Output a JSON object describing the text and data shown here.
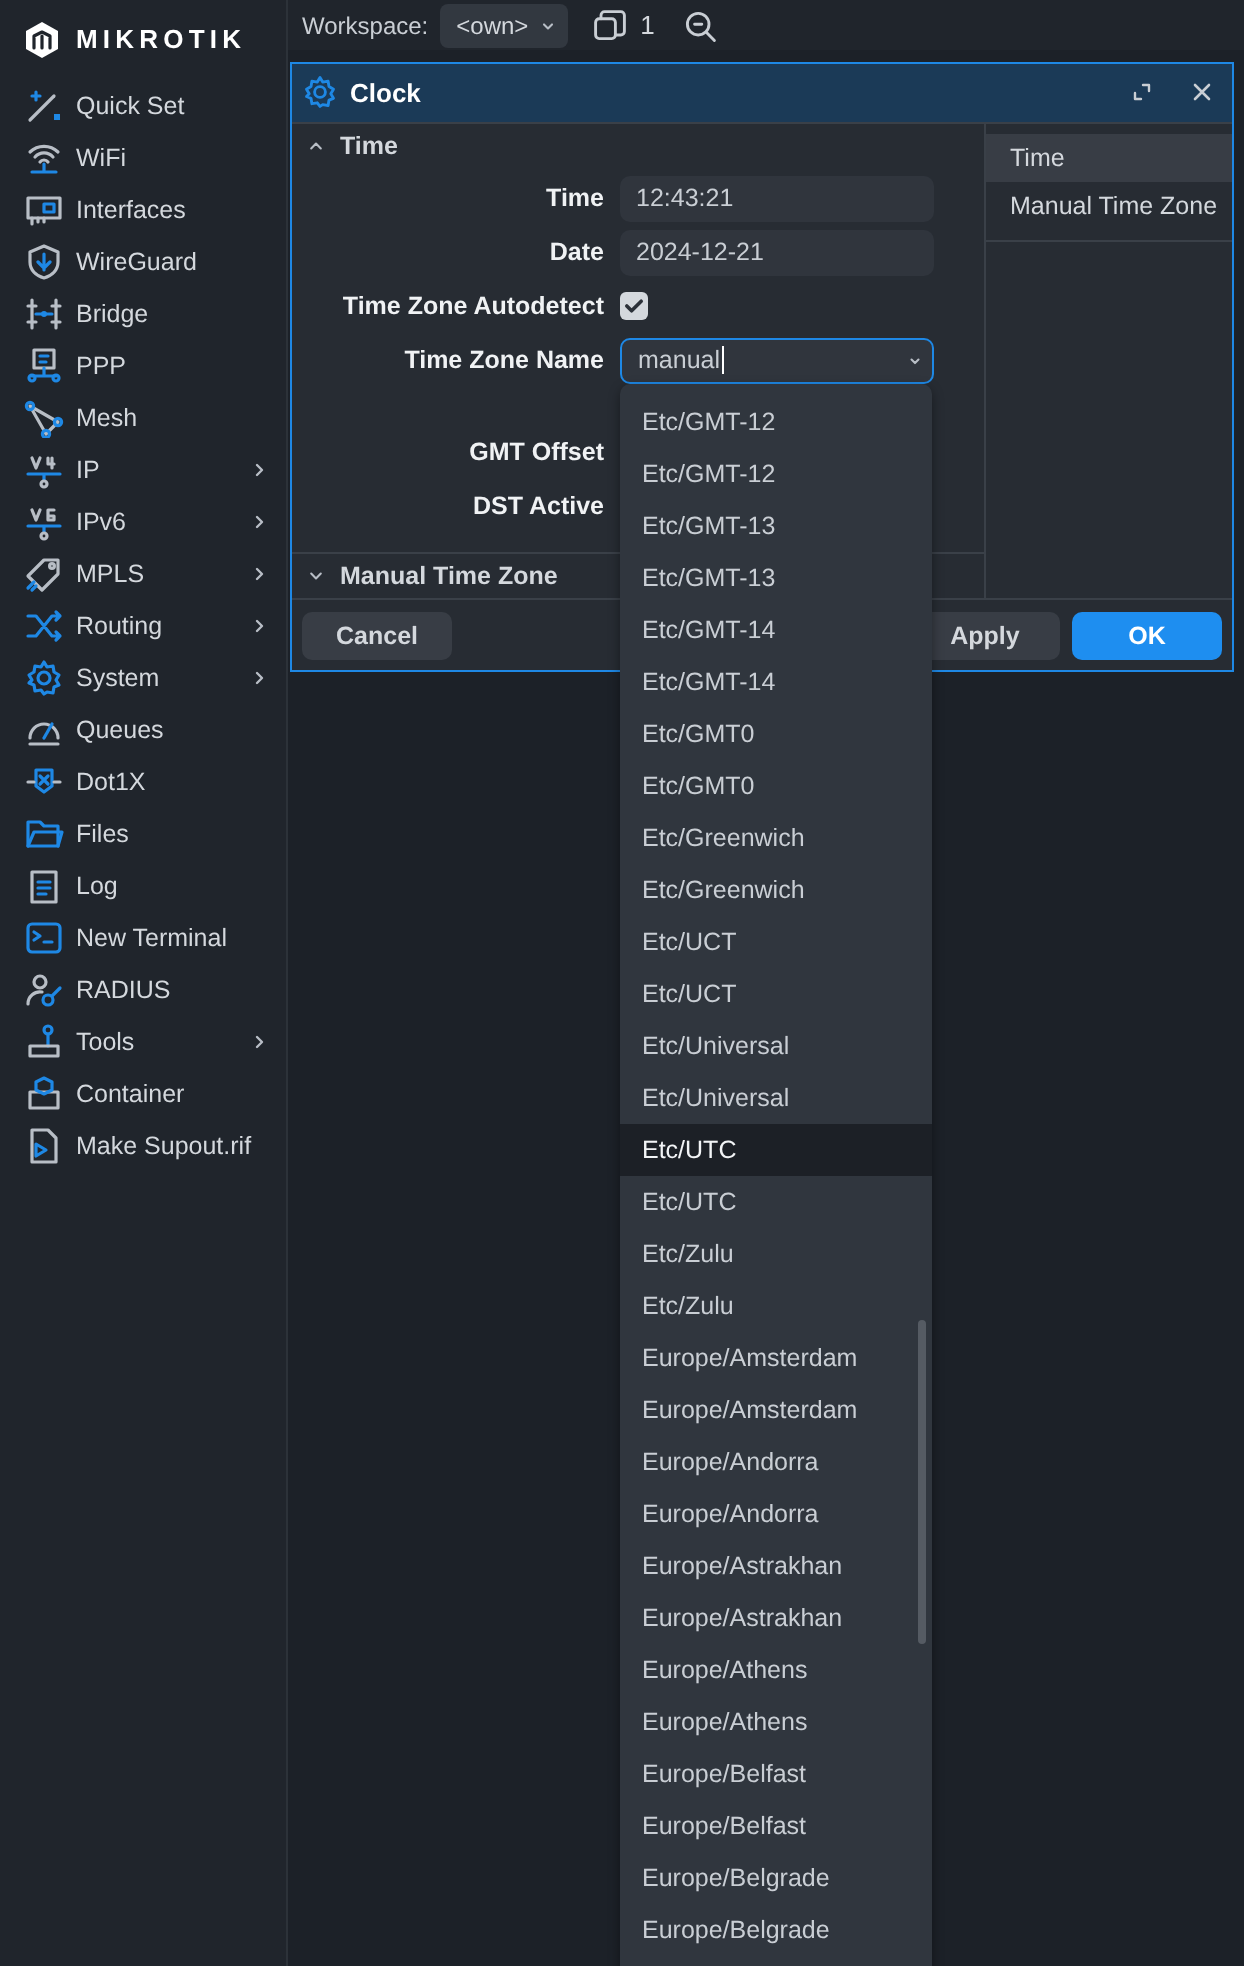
{
  "brand": {
    "name": "MIKROTIK"
  },
  "sidebar": {
    "items": [
      {
        "label": "Quick Set",
        "has_submenu": false
      },
      {
        "label": "WiFi",
        "has_submenu": false
      },
      {
        "label": "Interfaces",
        "has_submenu": false
      },
      {
        "label": "WireGuard",
        "has_submenu": false
      },
      {
        "label": "Bridge",
        "has_submenu": false
      },
      {
        "label": "PPP",
        "has_submenu": false
      },
      {
        "label": "Mesh",
        "has_submenu": false
      },
      {
        "label": "IP",
        "has_submenu": true
      },
      {
        "label": "IPv6",
        "has_submenu": true
      },
      {
        "label": "MPLS",
        "has_submenu": true
      },
      {
        "label": "Routing",
        "has_submenu": true
      },
      {
        "label": "System",
        "has_submenu": true
      },
      {
        "label": "Queues",
        "has_submenu": false
      },
      {
        "label": "Dot1X",
        "has_submenu": false
      },
      {
        "label": "Files",
        "has_submenu": false
      },
      {
        "label": "Log",
        "has_submenu": false
      },
      {
        "label": "New Terminal",
        "has_submenu": false
      },
      {
        "label": "RADIUS",
        "has_submenu": false
      },
      {
        "label": "Tools",
        "has_submenu": true
      },
      {
        "label": "Container",
        "has_submenu": false
      },
      {
        "label": "Make Supout.rif",
        "has_submenu": false
      }
    ]
  },
  "toolbar": {
    "workspace_label": "Workspace:",
    "workspace_value": "<own>",
    "window_count": "1"
  },
  "window": {
    "title": "Clock",
    "sections": [
      {
        "title": "Time",
        "expanded": true,
        "fields": [
          {
            "kind": "text",
            "label": "Time",
            "value": "12:43:21"
          },
          {
            "kind": "text",
            "label": "Date",
            "value": "2024-12-21"
          },
          {
            "kind": "checkbox",
            "label": "Time Zone Autodetect",
            "checked": true
          },
          {
            "kind": "select",
            "label": "Time Zone Name",
            "value": "manual",
            "focused": true
          },
          {
            "kind": "label",
            "label": "GMT Offset"
          },
          {
            "kind": "label",
            "label": "DST Active"
          }
        ]
      },
      {
        "title": "Manual Time Zone",
        "expanded": false
      }
    ],
    "nav": [
      {
        "label": "Time",
        "selected": true
      },
      {
        "label": "Manual Time Zone",
        "selected": false
      }
    ],
    "buttons": [
      {
        "label": "Cancel",
        "kind": "secondary"
      },
      {
        "label": "Apply",
        "kind": "secondary"
      },
      {
        "label": "OK",
        "kind": "primary"
      }
    ]
  },
  "dropdown": {
    "options": [
      {
        "label": "Etc/GMT-12",
        "highlighted": false
      },
      {
        "label": "Etc/GMT-12",
        "highlighted": false
      },
      {
        "label": "Etc/GMT-13",
        "highlighted": false
      },
      {
        "label": "Etc/GMT-13",
        "highlighted": false
      },
      {
        "label": "Etc/GMT-14",
        "highlighted": false
      },
      {
        "label": "Etc/GMT-14",
        "highlighted": false
      },
      {
        "label": "Etc/GMT0",
        "highlighted": false
      },
      {
        "label": "Etc/GMT0",
        "highlighted": false
      },
      {
        "label": "Etc/Greenwich",
        "highlighted": false
      },
      {
        "label": "Etc/Greenwich",
        "highlighted": false
      },
      {
        "label": "Etc/UCT",
        "highlighted": false
      },
      {
        "label": "Etc/UCT",
        "highlighted": false
      },
      {
        "label": "Etc/Universal",
        "highlighted": false
      },
      {
        "label": "Etc/Universal",
        "highlighted": false
      },
      {
        "label": "Etc/UTC",
        "highlighted": true
      },
      {
        "label": "Etc/UTC",
        "highlighted": false
      },
      {
        "label": "Etc/Zulu",
        "highlighted": false
      },
      {
        "label": "Etc/Zulu",
        "highlighted": false
      },
      {
        "label": "Europe/Amsterdam",
        "highlighted": false
      },
      {
        "label": "Europe/Amsterdam",
        "highlighted": false
      },
      {
        "label": "Europe/Andorra",
        "highlighted": false
      },
      {
        "label": "Europe/Andorra",
        "highlighted": false
      },
      {
        "label": "Europe/Astrakhan",
        "highlighted": false
      },
      {
        "label": "Europe/Astrakhan",
        "highlighted": false
      },
      {
        "label": "Europe/Athens",
        "highlighted": false
      },
      {
        "label": "Europe/Athens",
        "highlighted": false
      },
      {
        "label": "Europe/Belfast",
        "highlighted": false
      },
      {
        "label": "Europe/Belfast",
        "highlighted": false
      },
      {
        "label": "Europe/Belgrade",
        "highlighted": false
      },
      {
        "label": "Europe/Belgrade",
        "highlighted": false
      }
    ]
  }
}
